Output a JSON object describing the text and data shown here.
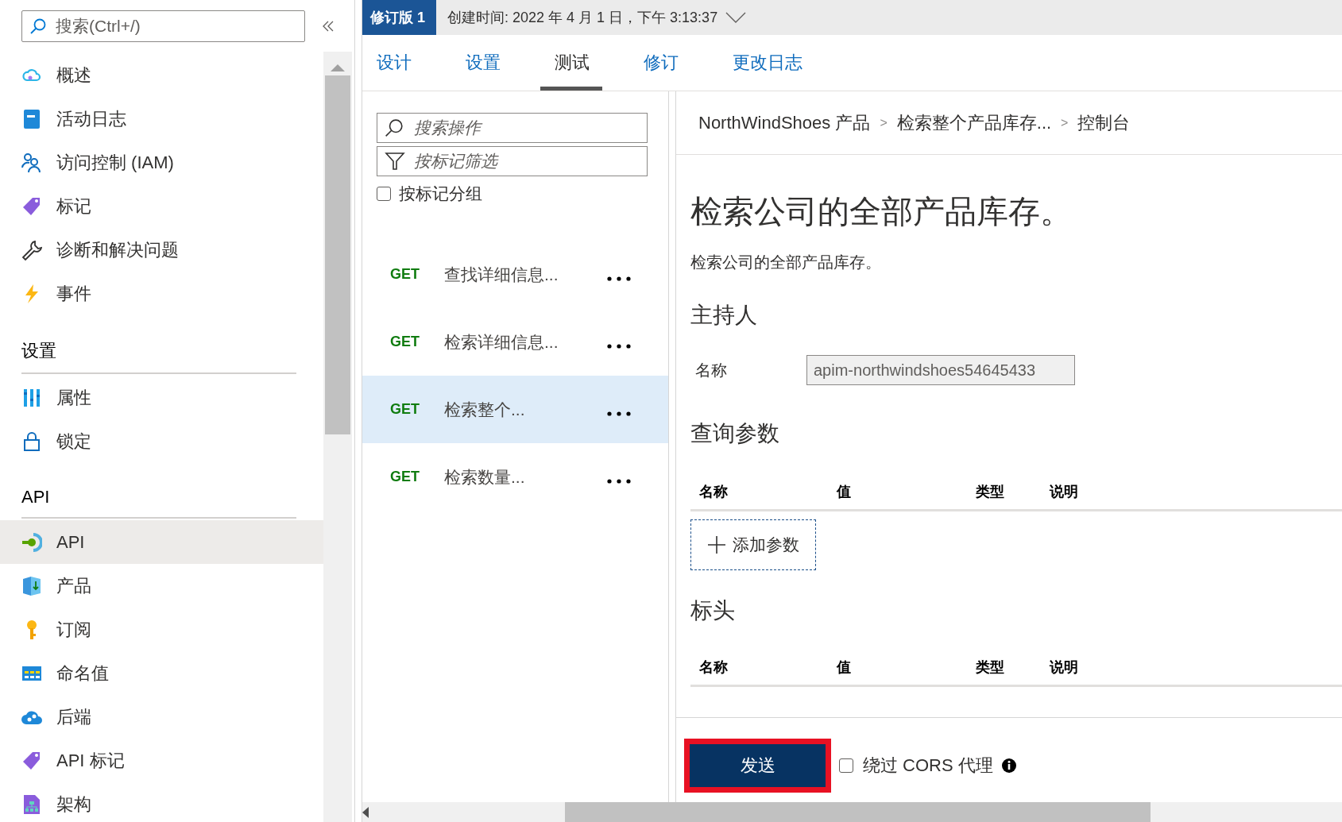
{
  "sidebar": {
    "search": {
      "placeholder": "搜索(Ctrl+/)"
    },
    "sections": [
      {
        "items": [
          {
            "label": "概述",
            "selected": false
          },
          {
            "label": "活动日志",
            "selected": false
          },
          {
            "label": "访问控制 (IAM)",
            "selected": false
          },
          {
            "label": "标记",
            "selected": false
          },
          {
            "label": "诊断和解决问题",
            "selected": false
          },
          {
            "label": "事件",
            "selected": false
          }
        ]
      },
      {
        "title": "设置",
        "items": [
          {
            "label": "属性",
            "selected": false
          },
          {
            "label": "锁定",
            "selected": false
          }
        ]
      },
      {
        "title": "API",
        "items": [
          {
            "label": "API",
            "selected": true
          },
          {
            "label": "产品",
            "selected": false
          },
          {
            "label": "订阅",
            "selected": false
          },
          {
            "label": "命名值",
            "selected": false
          },
          {
            "label": "后端",
            "selected": false
          },
          {
            "label": "API 标记",
            "selected": false
          },
          {
            "label": "架构",
            "selected": false
          }
        ]
      }
    ]
  },
  "revision": {
    "badge": "修订版 1",
    "created": "创建时间: 2022 年 4 月 1 日，下午 3:13:37"
  },
  "tabs": [
    {
      "label": "设计",
      "selected": false
    },
    {
      "label": "设置",
      "selected": false
    },
    {
      "label": "测试",
      "selected": true
    },
    {
      "label": "修订",
      "selected": false
    },
    {
      "label": "更改日志",
      "selected": false
    }
  ],
  "operations": {
    "search": {
      "placeholder": "搜索操作"
    },
    "filter": {
      "placeholder": "按标记筛选"
    },
    "group_by_tag": {
      "label": "按标记分组",
      "checked": false
    },
    "items": [
      {
        "method": "GET",
        "name": "查找详细信息...",
        "selected": false
      },
      {
        "method": "GET",
        "name": "检索详细信息...",
        "selected": false
      },
      {
        "method": "GET",
        "name": "检索整个...",
        "selected": true
      },
      {
        "method": "GET",
        "name": "检索数量...",
        "selected": false
      }
    ]
  },
  "console": {
    "breadcrumb": {
      "items": [
        "NorthWindShoes 产品",
        "检索整个产品库存...",
        "控制台"
      ],
      "separator": ">"
    },
    "title": "检索公司的全部产品库存。",
    "description": "检索公司的全部产品库存。",
    "host": {
      "heading": "主持人",
      "label": "名称",
      "value": "apim-northwindshoes54645433"
    },
    "query": {
      "heading": "查询参数",
      "columns": [
        "名称",
        "值",
        "类型",
        "说明"
      ],
      "add_button": "添加参数"
    },
    "headers": {
      "heading": "标头",
      "columns": [
        "名称",
        "值",
        "类型",
        "说明"
      ]
    },
    "send_button": "发送",
    "bypass_cors": {
      "label": "绕过 CORS 代理",
      "checked": false
    }
  }
}
